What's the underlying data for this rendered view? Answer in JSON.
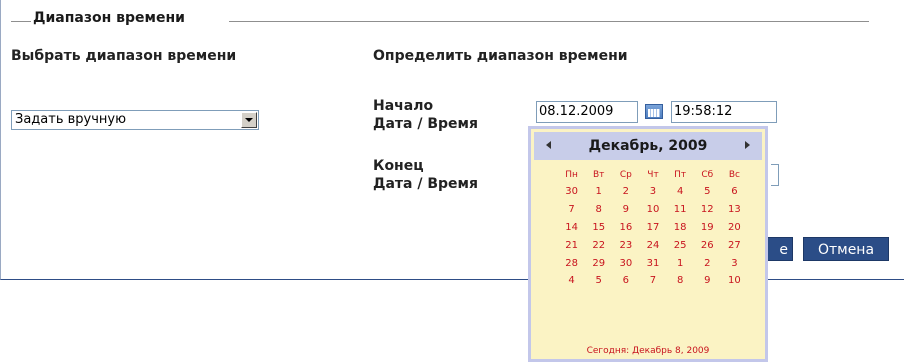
{
  "fieldset": {
    "legend": "Диапазон времени"
  },
  "select_range": {
    "title": "Выбрать диапазон времени",
    "value": "Задать вручную"
  },
  "define_range": {
    "title": "Определить диапазон времени",
    "start_label_line1": "Начало",
    "start_label_line2": "Дата / Время",
    "end_label_line1": "Конец",
    "end_label_line2": "Дата / Время",
    "start_date": "08.12.2009",
    "start_time": "19:58:12"
  },
  "buttons": {
    "save_partial": "е",
    "cancel": "Отмена"
  },
  "calendar": {
    "title": "Декабрь, 2009",
    "weekdays": [
      "Пн",
      "Вт",
      "Ср",
      "Чт",
      "Пт",
      "Сб",
      "Вс"
    ],
    "weeks": [
      [
        "30",
        "1",
        "2",
        "3",
        "4",
        "5",
        "6"
      ],
      [
        "7",
        "8",
        "9",
        "10",
        "11",
        "12",
        "13"
      ],
      [
        "14",
        "15",
        "16",
        "17",
        "18",
        "19",
        "20"
      ],
      [
        "21",
        "22",
        "23",
        "24",
        "25",
        "26",
        "27"
      ],
      [
        "28",
        "29",
        "30",
        "31",
        "1",
        "2",
        "3"
      ],
      [
        "4",
        "5",
        "6",
        "7",
        "8",
        "9",
        "10"
      ]
    ],
    "footer": "Сегодня: Декабрь 8, 2009"
  },
  "colors": {
    "button_bg": "#2b4d87",
    "calendar_bg": "#fbf3c4",
    "calendar_header": "#c8cde9",
    "calendar_day_text": "#c8141e"
  }
}
